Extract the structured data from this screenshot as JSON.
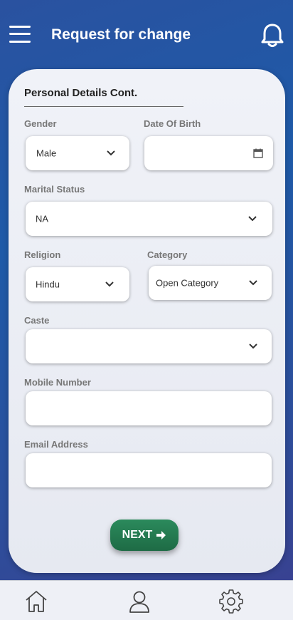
{
  "header": {
    "title": "Request for change"
  },
  "form": {
    "section_title": "Personal Details Cont.",
    "gender": {
      "label": "Gender",
      "value": "Male"
    },
    "dob": {
      "label": "Date Of Birth",
      "value": ""
    },
    "marital_status": {
      "label": "Marital Status",
      "value": "NA"
    },
    "religion": {
      "label": "Religion",
      "value": "Hindu"
    },
    "category": {
      "label": "Category",
      "value": "Open Category"
    },
    "caste": {
      "label": "Caste",
      "value": ""
    },
    "mobile": {
      "label": "Mobile Number",
      "value": ""
    },
    "email": {
      "label": "Email Address",
      "value": ""
    },
    "next_label": "NEXT"
  },
  "nav": {
    "icons": [
      "home-icon",
      "profile-icon",
      "settings-icon"
    ]
  },
  "colors": {
    "accent": "#1e6b45",
    "header_bg": "#1e5aa8"
  }
}
